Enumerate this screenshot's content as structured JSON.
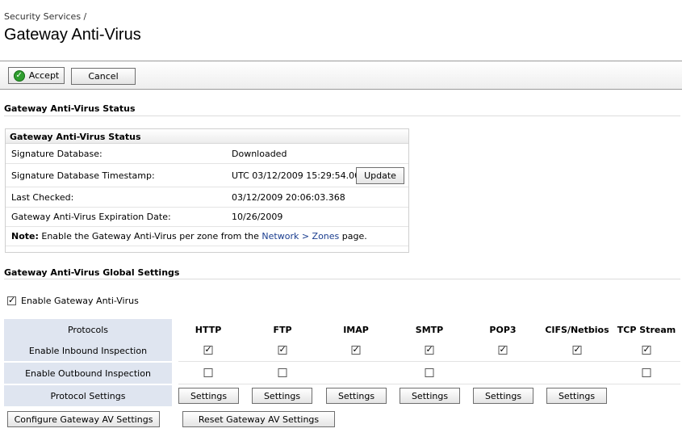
{
  "breadcrumb": "Security Services /",
  "page_title": "Gateway Anti-Virus",
  "toolbar": {
    "accept_label": "Accept",
    "cancel_label": "Cancel"
  },
  "status_section": {
    "title": "Gateway Anti-Virus Status",
    "box_title": "Gateway Anti-Virus Status",
    "rows": [
      {
        "label": "Signature Database:",
        "value": "Downloaded"
      },
      {
        "label": "Signature Database Timestamp:",
        "value": "UTC 03/12/2009 15:29:54.000"
      },
      {
        "label": "Last Checked:",
        "value": "03/12/2009 20:06:03.368"
      },
      {
        "label": "Gateway Anti-Virus Expiration Date:",
        "value": "10/26/2009"
      }
    ],
    "update_label": "Update",
    "note": {
      "bold": "Note:",
      "text_before": " Enable the Gateway Anti-Virus per zone from the ",
      "link": "Network > Zones",
      "text_after": " page."
    }
  },
  "global_section": {
    "title": "Gateway Anti-Virus Global Settings",
    "enable_label": "Enable Gateway Anti-Virus",
    "enable_checked": true,
    "row_labels": {
      "protocols": "Protocols",
      "inbound": "Enable Inbound Inspection",
      "outbound": "Enable Outbound Inspection",
      "settings": "Protocol Settings"
    },
    "columns": [
      "HTTP",
      "FTP",
      "IMAP",
      "SMTP",
      "POP3",
      "CIFS/Netbios",
      "TCP Stream"
    ],
    "inbound": [
      true,
      true,
      true,
      true,
      true,
      true,
      true
    ],
    "outbound": [
      false,
      false,
      null,
      false,
      null,
      null,
      false
    ],
    "settings_label": "Settings"
  },
  "footer": {
    "configure_label": "Configure Gateway AV Settings",
    "reset_label": "Reset Gateway AV Settings"
  }
}
